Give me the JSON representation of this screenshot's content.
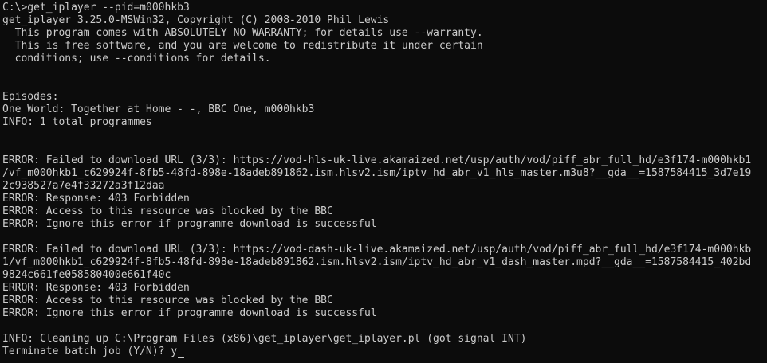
{
  "console": {
    "lines": [
      "C:\\>get_iplayer --pid=m000hkb3",
      "get_iplayer 3.25.0-MSWin32, Copyright (C) 2008-2010 Phil Lewis",
      "  This program comes with ABSOLUTELY NO WARRANTY; for details use --warranty.",
      "  This is free software, and you are welcome to redistribute it under certain",
      "  conditions; use --conditions for details.",
      "",
      "",
      "Episodes:",
      "One World: Together at Home - -, BBC One, m000hkb3",
      "INFO: 1 total programmes",
      "",
      "",
      "ERROR: Failed to download URL (3/3): https://vod-hls-uk-live.akamaized.net/usp/auth/vod/piff_abr_full_hd/e3f174-m000hkb1",
      "/vf_m000hkb1_c629924f-8fb5-48fd-898e-18adeb891862.ism.hlsv2.ism/iptv_hd_abr_v1_hls_master.m3u8?__gda__=1587584415_3d7e19",
      "2c938527a7e4f33272a3f12daa",
      "ERROR: Response: 403 Forbidden",
      "ERROR: Access to this resource was blocked by the BBC",
      "ERROR: Ignore this error if programme download is successful",
      "",
      "ERROR: Failed to download URL (3/3): https://vod-dash-uk-live.akamaized.net/usp/auth/vod/piff_abr_full_hd/e3f174-m000hkb",
      "1/vf_m000hkb1_c629924f-8fb5-48fd-898e-18adeb891862.ism.hlsv2.ism/iptv_hd_abr_v1_dash_master.mpd?__gda__=1587584415_402bd",
      "9824c661fe058580400e661f40c",
      "ERROR: Response: 403 Forbidden",
      "ERROR: Access to this resource was blocked by the BBC",
      "ERROR: Ignore this error if programme download is successful",
      "",
      "INFO: Cleaning up C:\\Program Files (x86)\\get_iplayer\\get_iplayer.pl (got signal INT)",
      "Terminate batch job (Y/N)? y"
    ]
  },
  "colors": {
    "background": "#0c0c0c",
    "foreground": "#cccccc"
  }
}
